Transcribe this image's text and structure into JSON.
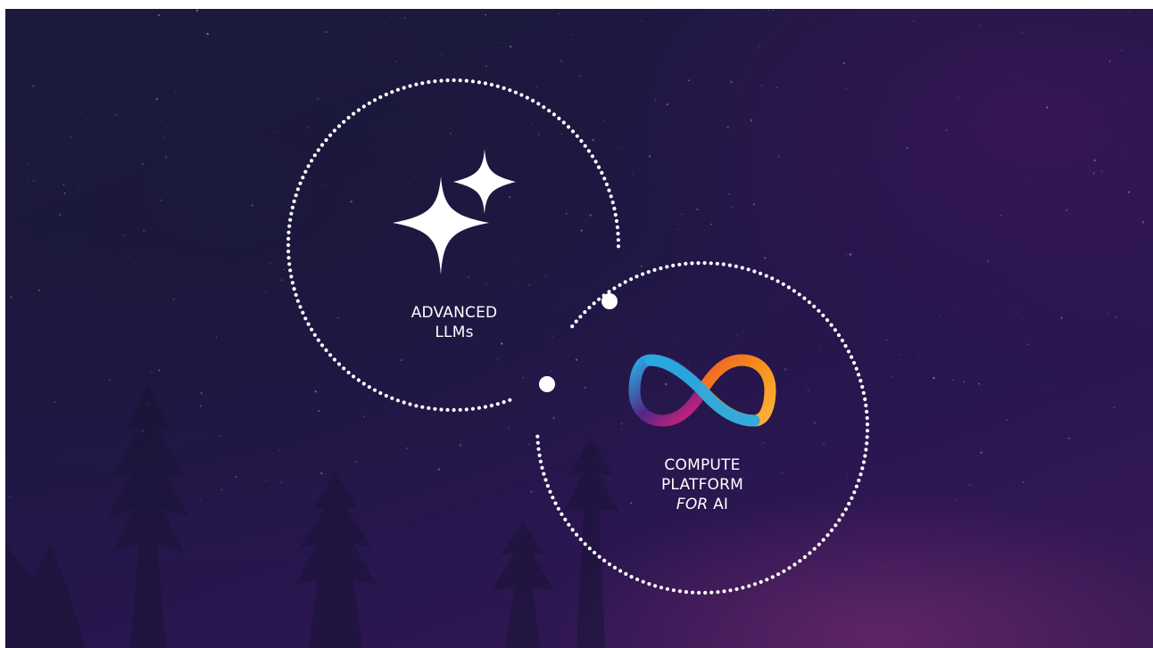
{
  "nodes": {
    "llm": {
      "line1": "ADVANCED",
      "line2": "LLMs",
      "icon": "sparkles-icon"
    },
    "compute": {
      "line1": "COMPUTE",
      "line2": "PLATFORM",
      "line3_italic": "FOR",
      "line3_rest": "AI",
      "icon": "infinity-logo"
    }
  },
  "colors": {
    "background": "#201844",
    "dots": "#ffffff",
    "logo_orange": "#f7931e",
    "logo_pink": "#ed1e79",
    "logo_purple": "#522785",
    "logo_blue": "#29abe2"
  }
}
